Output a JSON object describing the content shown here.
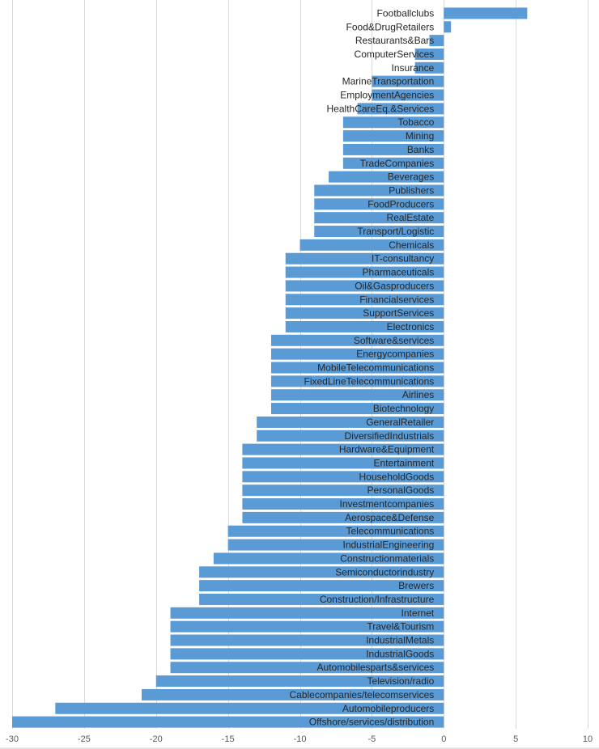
{
  "chart_data": {
    "type": "bar",
    "orientation": "horizontal",
    "title": "",
    "xlabel": "",
    "ylabel": "",
    "xlim": [
      -30,
      10
    ],
    "x_ticks": [
      -30,
      -25,
      -20,
      -15,
      -10,
      -5,
      0,
      5,
      10
    ],
    "x_tick_labels": [
      "-30",
      "-25",
      "-20",
      "-15",
      "-10",
      "-5",
      "0",
      "5",
      "10"
    ],
    "grid": true,
    "legend": "none",
    "bar_color": "#5b9bd5",
    "categories": [
      "Footballclubs",
      "Food&DrugRetailers",
      "Restaurants&Bars",
      "ComputerServices",
      "Insurance",
      "MarineTransportation",
      "EmploymentAgencies",
      "HealthCareEq.&Services",
      "Tobacco",
      "Mining",
      "Banks",
      "TradeCompanies",
      "Beverages",
      "Publishers",
      "FoodProducers",
      "RealEstate",
      "Transport/Logistic",
      "Chemicals",
      "IT-consultancy",
      "Pharmaceuticals",
      "Oil&Gasproducers",
      "Financialservices",
      "SupportServices",
      "Electronics",
      "Software&services",
      "Energycompanies",
      "MobileTelecommunications",
      "FixedLineTelecommunications",
      "Airlines",
      "Biotechnology",
      "GeneralRetailer",
      "DiversifiedIndustrials",
      "Hardware&Equipment",
      "Entertainment",
      "HouseholdGoods",
      "PersonalGoods",
      "Investmentcompanies",
      "Aerospace&Defense",
      "Telecommunications",
      "IndustrialEngineering",
      "Constructionmaterials",
      "Semiconductorindustry",
      "Brewers",
      "Construction/Infrastructure",
      "Internet",
      "Travel&Tourism",
      "IndustrialMetals",
      "IndustrialGoods",
      "Automobilesparts&services",
      "Television/radio",
      "Cablecompanies/telecomservices",
      "Automobileproducers",
      "Offshore/services/distribution"
    ],
    "values": [
      5.8,
      0.5,
      -1,
      -2,
      -2,
      -5,
      -5,
      -6,
      -7,
      -7,
      -7,
      -7,
      -8,
      -9,
      -9,
      -9,
      -9,
      -10,
      -11,
      -11,
      -11,
      -11,
      -11,
      -11,
      -12,
      -12,
      -12,
      -12,
      -12,
      -12,
      -13,
      -13,
      -14,
      -14,
      -14,
      -14,
      -14,
      -14,
      -15,
      -15,
      -16,
      -17,
      -17,
      -17,
      -19,
      -19,
      -19,
      -19,
      -19,
      -20,
      -21,
      -27,
      -30
    ]
  }
}
